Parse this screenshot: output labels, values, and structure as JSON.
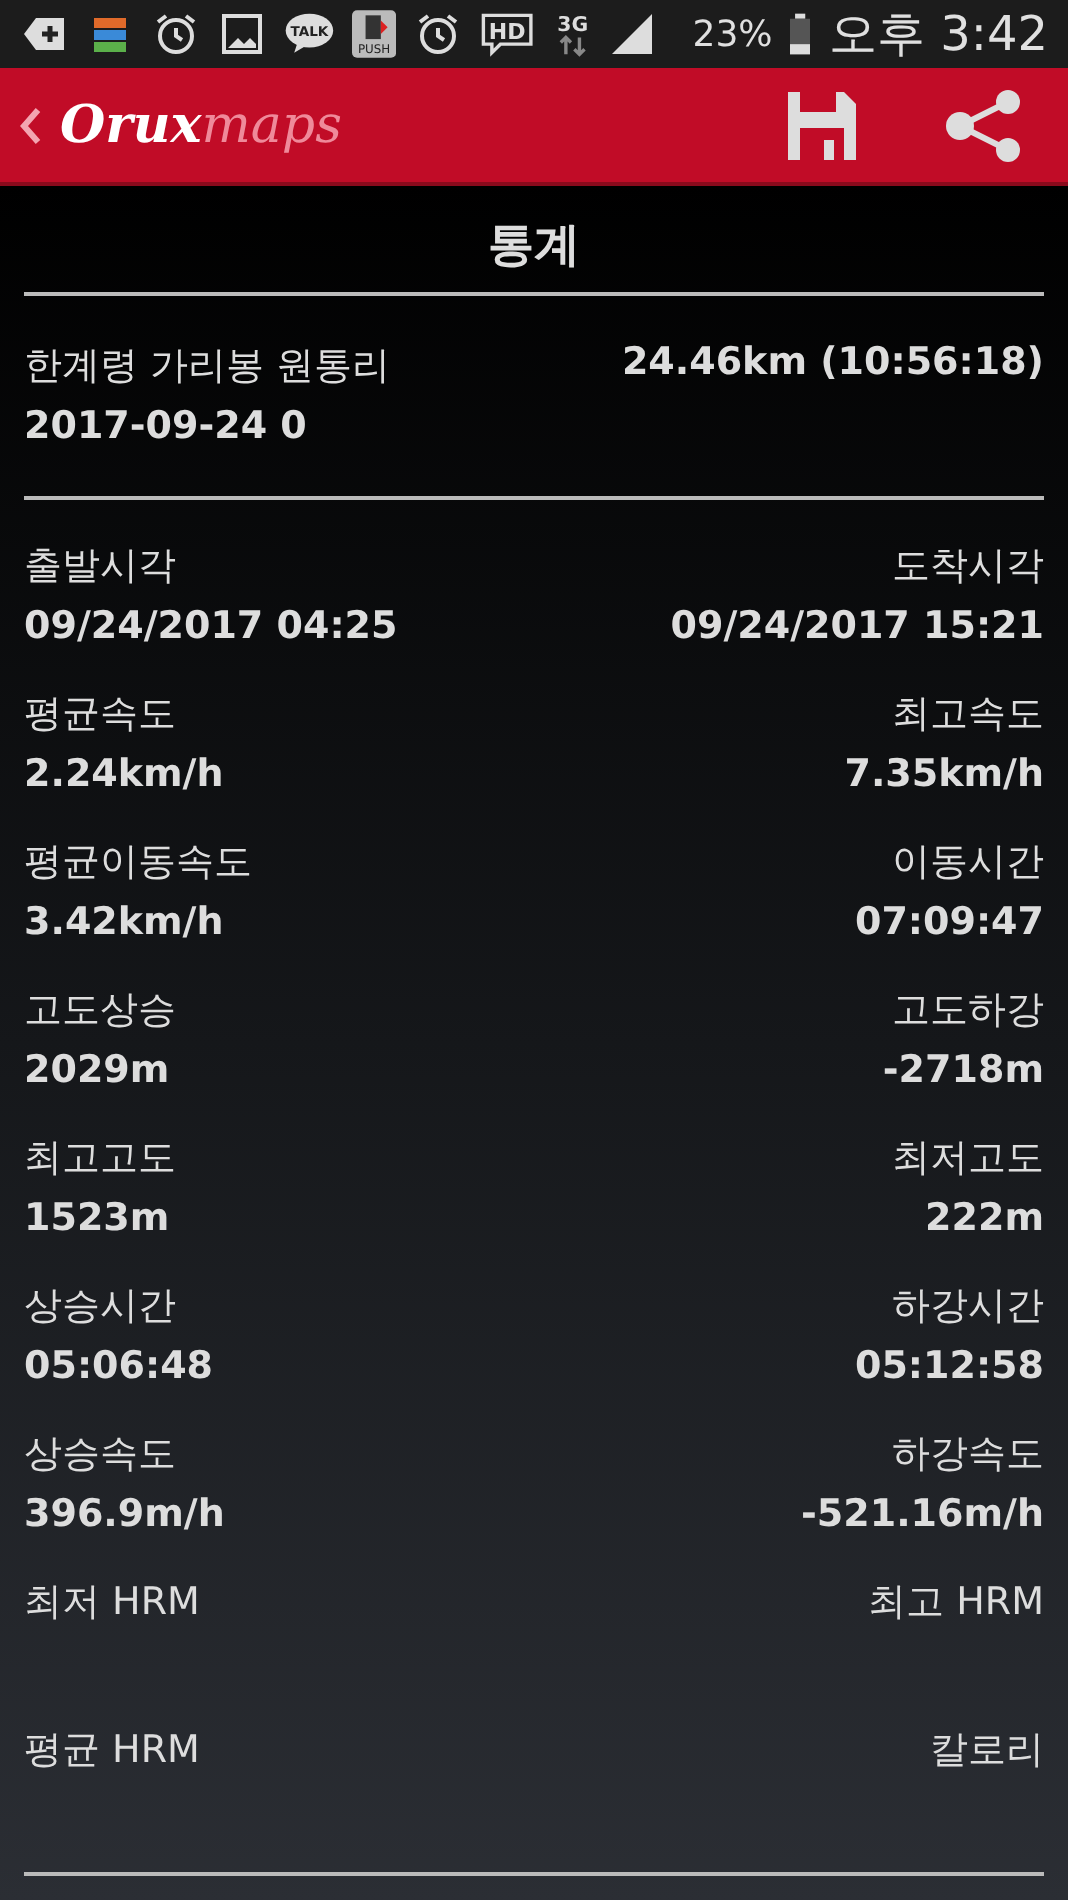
{
  "status_bar": {
    "items": [
      {
        "kind": "add"
      },
      {
        "kind": "stack"
      },
      {
        "kind": "alarm"
      },
      {
        "kind": "image"
      },
      {
        "kind": "bubble",
        "text": "TALK"
      },
      {
        "kind": "push",
        "text": "PUSH"
      },
      {
        "kind": "alarm"
      },
      {
        "kind": "hd",
        "text": "HD"
      },
      {
        "kind": "network",
        "text": "3G"
      },
      {
        "kind": "signal"
      }
    ],
    "battery": "23%",
    "time": "오후 3:42"
  },
  "app_bar": {
    "logo_main": "Orux",
    "logo_sub": "maps"
  },
  "title": "통계",
  "track": {
    "name": "한계령 가리봉 원통리",
    "date": "2017-09-24 0",
    "summary": "24.46km (10:56:18)"
  },
  "stats": [
    {
      "left_label": "출발시각",
      "left_value": "09/24/2017 04:25",
      "right_label": "도착시각",
      "right_value": "09/24/2017 15:21"
    },
    {
      "left_label": "평균속도",
      "left_value": "2.24km/h",
      "right_label": "최고속도",
      "right_value": "7.35km/h"
    },
    {
      "left_label": "평균이동속도",
      "left_value": "3.42km/h",
      "right_label": "이동시간",
      "right_value": "07:09:47"
    },
    {
      "left_label": "고도상승",
      "left_value": "2029m",
      "right_label": "고도하강",
      "right_value": "-2718m"
    },
    {
      "left_label": "최고고도",
      "left_value": "1523m",
      "right_label": "최저고도",
      "right_value": "222m"
    },
    {
      "left_label": "상승시간",
      "left_value": "05:06:48",
      "right_label": "하강시간",
      "right_value": "05:12:58"
    },
    {
      "left_label": "상승속도",
      "left_value": "396.9m/h",
      "right_label": "하강속도",
      "right_value": "-521.16m/h"
    },
    {
      "left_label": "최저 HRM",
      "right_label": "최고 HRM"
    },
    {
      "left_label": "평균 HRM",
      "right_label": "칼로리"
    }
  ]
}
